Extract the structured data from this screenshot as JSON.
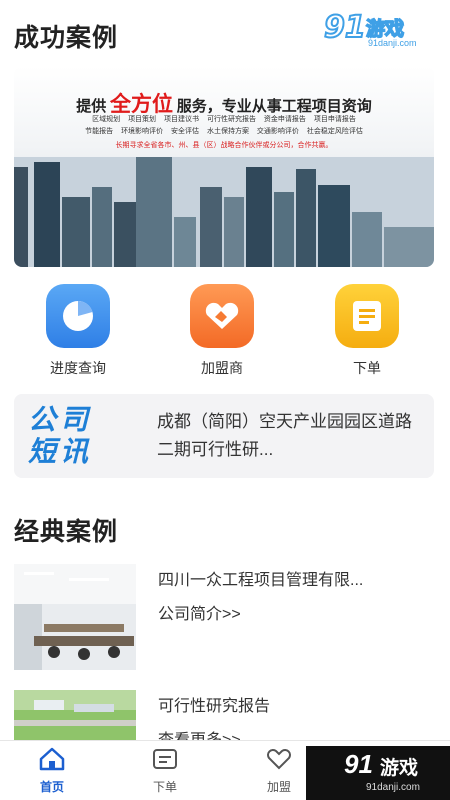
{
  "sections": {
    "success_cases_title": "成功案例",
    "classic_cases_title": "经典案例"
  },
  "watermark": {
    "brand_number": "91",
    "brand_text": "游戏",
    "url": "91danji.com"
  },
  "banner": {
    "headline_prefix": "提供",
    "headline_highlight": "全方位",
    "headline_suffix": "服务，专业从事工程项目资询",
    "tags_row1": [
      "区域规划",
      "项目策划",
      "项目建议书",
      "可行性研究报告",
      "资金申请报告",
      "项目申请报告"
    ],
    "tags_row2": [
      "节能报告",
      "环境影响评价",
      "安全评估",
      "水土保持方案",
      "交通影响评价",
      "社会稳定风险评估"
    ],
    "red_note": "长期寻求全省各市、州、县（区）战略合作伙伴或分公司，合作共赢。",
    "colors": {
      "highlight": "#e01b1b"
    }
  },
  "quick_actions": [
    {
      "label": "进度查询",
      "icon": "pie-chart-icon",
      "color": "#3d8ef0"
    },
    {
      "label": "加盟商",
      "icon": "handshake-icon",
      "color": "#f67a32"
    },
    {
      "label": "下单",
      "icon": "document-icon",
      "color": "#f8be1f"
    }
  ],
  "news": {
    "logo_line1": "公司",
    "logo_line2": "短讯",
    "text": "成都（简阳）空天产业园园区道路二期可行性研..."
  },
  "cases": [
    {
      "title": "四川一众工程项目管理有限...",
      "subtitle": "公司简介>>"
    },
    {
      "title": "可行性研究报告",
      "subtitle": "查看更多>>"
    }
  ],
  "tabbar": [
    {
      "label": "首页",
      "icon": "home-icon",
      "active": true
    },
    {
      "label": "下单",
      "icon": "order-icon",
      "active": false
    },
    {
      "label": "加盟",
      "icon": "join-icon",
      "active": false
    }
  ],
  "colors": {
    "accent": "#1c5fd0",
    "news_logo": "#1e7fd6"
  }
}
